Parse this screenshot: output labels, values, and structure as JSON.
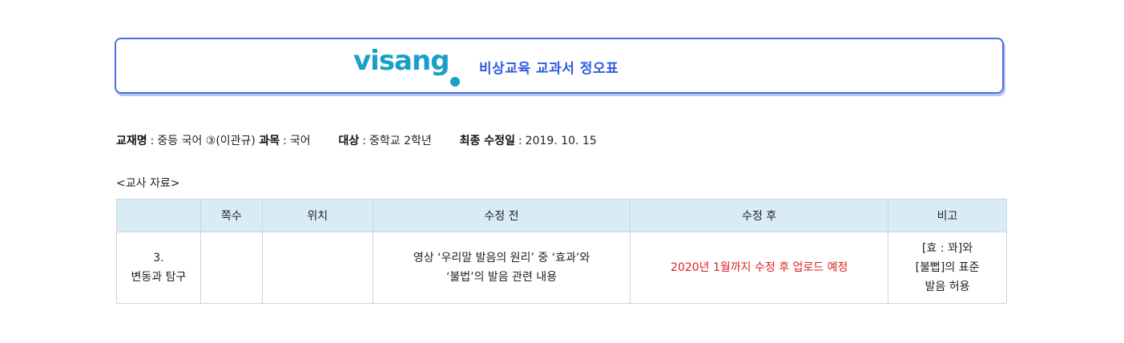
{
  "banner": {
    "logo_text": "visang",
    "title": "비상교육 교과서 정오표"
  },
  "meta": {
    "textbook_key": "교재명",
    "textbook_value": "중등 국어 ③(이관규)",
    "subject_key": "과목",
    "subject_value": "국어",
    "target_key": "대상",
    "target_value": "중학교 2학년",
    "revised_key": "최종 수정일",
    "revised_value": "2019. 10. 15",
    "separator": ":"
  },
  "section_title": "<교사 자료>",
  "table": {
    "headers": [
      "",
      "쪽수",
      "위치",
      "수정 전",
      "수정 후",
      "비고"
    ],
    "rows": [
      {
        "unit_line1": "3.",
        "unit_line2": "변동과 탐구",
        "page": "",
        "location": "",
        "before_line1": "영상 ‘우리말 발음의 원리’ 중 ‘효과’와",
        "before_line2": "‘불법’의 발음 관련 내용",
        "after": "2020년 1월까지 수정 후 업로드 예정",
        "note_line1": "[효 : 꽈]와",
        "note_line2": "[불뻡]의 표준",
        "note_line3": "발음 허용"
      }
    ]
  },
  "colors": {
    "brand_teal": "#1aa0c8",
    "title_blue": "#2f5be0",
    "header_bg": "#d9ecf6",
    "correction_red": "#e02020"
  }
}
